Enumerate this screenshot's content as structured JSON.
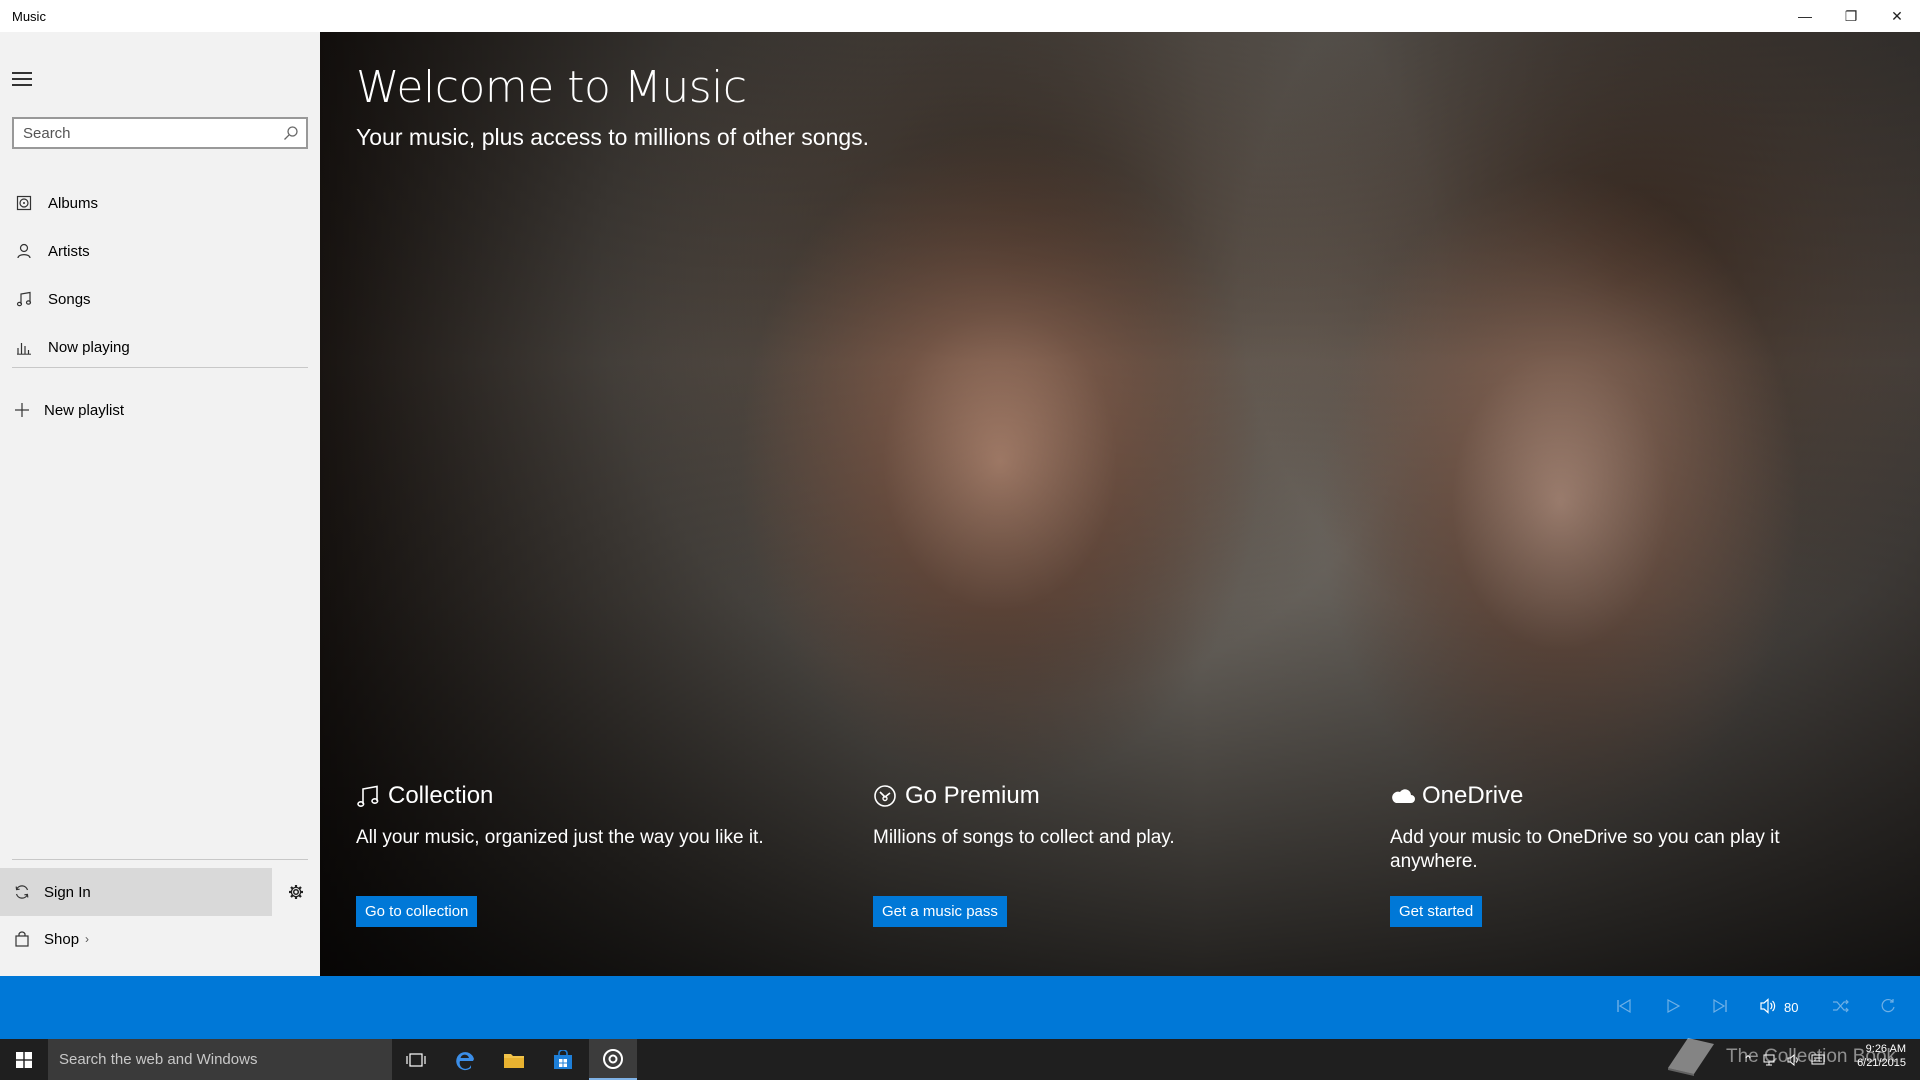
{
  "window": {
    "title": "Music",
    "controls": {
      "minimize": "—",
      "restore": "❐",
      "close": "✕"
    }
  },
  "sidebar": {
    "search_placeholder": "Search",
    "items": [
      {
        "label": "Albums",
        "icon": "album-icon"
      },
      {
        "label": "Artists",
        "icon": "person-icon"
      },
      {
        "label": "Songs",
        "icon": "music-note-icon"
      },
      {
        "label": "Now playing",
        "icon": "equalizer-icon"
      }
    ],
    "new_playlist": "New playlist",
    "sign_in": "Sign In",
    "shop": "Shop",
    "shop_chevron": "›"
  },
  "hero": {
    "title": "Welcome to Music",
    "subtitle": "Your music, plus access to millions of other songs.",
    "cards": [
      {
        "title": "Collection",
        "description": "All your music, organized just the way you like it.",
        "button": "Go to collection",
        "icon": "music-note-icon"
      },
      {
        "title": "Go Premium",
        "description": "Millions of songs to collect and play.",
        "button": "Get a music pass",
        "icon": "premium-icon"
      },
      {
        "title": "OneDrive",
        "description": "Add your music to OneDrive so you can play it anywhere.",
        "button": "Get started",
        "icon": "cloud-icon"
      }
    ]
  },
  "player": {
    "volume": "80"
  },
  "taskbar": {
    "search_placeholder": "Search the web and Windows",
    "watermark": "The Collection Book",
    "time": "9:26 AM",
    "date": "6/21/2015"
  },
  "colors": {
    "accent": "#0078d7",
    "sidebar_bg": "#f2f2f2",
    "taskbar_bg": "#1f1f1f"
  }
}
